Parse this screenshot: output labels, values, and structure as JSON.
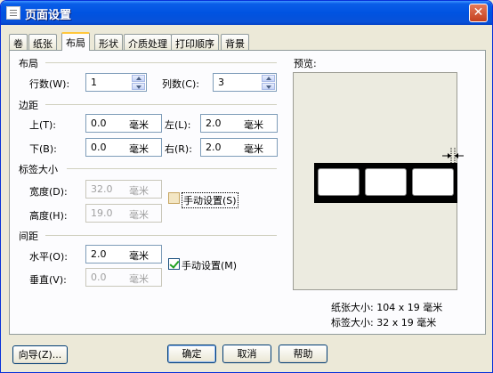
{
  "window": {
    "title": "页面设置",
    "close": "✕"
  },
  "tabs": [
    "卷",
    "纸张",
    "布局",
    "形状",
    "介质处理",
    "打印顺序",
    "背景"
  ],
  "layout": {
    "title": "布局",
    "rows_label": "行数(W):",
    "rows_value": "1",
    "cols_label": "列数(C):",
    "cols_value": "3"
  },
  "margins": {
    "title": "边距",
    "top_label": "上(T):",
    "top_value": "0.0",
    "top_unit": "毫米",
    "left_label": "左(L):",
    "left_value": "2.0",
    "left_unit": "毫米",
    "bottom_label": "下(B):",
    "bottom_value": "0.0",
    "bottom_unit": "毫米",
    "right_label": "右(R):",
    "right_value": "2.0",
    "right_unit": "毫米"
  },
  "label_size": {
    "title": "标签大小",
    "width_label": "宽度(D):",
    "width_value": "32.0",
    "width_unit": "毫米",
    "height_label": "高度(H):",
    "height_value": "19.0",
    "height_unit": "毫米",
    "manual_label": "手动设置(S)",
    "manual_checked": false
  },
  "spacing": {
    "title": "间距",
    "h_label": "水平(O):",
    "h_value": "2.0",
    "h_unit": "毫米",
    "v_label": "垂直(V):",
    "v_value": "0.0",
    "v_unit": "毫米",
    "manual_label": "手动设置(M)",
    "manual_checked": true
  },
  "preview": {
    "title": "预览:",
    "paper_size": "纸张大小: 104 x 19 毫米",
    "label_size": "标签大小: 32 x 19 毫米"
  },
  "buttons": {
    "wizard": "向导(Z)...",
    "ok": "确定",
    "cancel": "取消",
    "help": "帮助"
  }
}
